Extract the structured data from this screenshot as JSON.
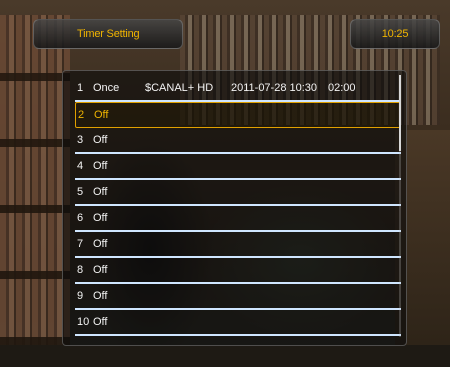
{
  "header": {
    "title": "Timer Setting",
    "clock": "10:25"
  },
  "timers": [
    {
      "index": "1",
      "mode": "Once",
      "channel": "$CANAL+ HD",
      "datetime": "2011-07-28 10:30",
      "duration": "02:00"
    },
    {
      "index": "2",
      "mode": "Off"
    },
    {
      "index": "3",
      "mode": "Off"
    },
    {
      "index": "4",
      "mode": "Off"
    },
    {
      "index": "5",
      "mode": "Off"
    },
    {
      "index": "6",
      "mode": "Off"
    },
    {
      "index": "7",
      "mode": "Off"
    },
    {
      "index": "8",
      "mode": "Off"
    },
    {
      "index": "9",
      "mode": "Off"
    },
    {
      "index": "10",
      "mode": "Off"
    }
  ],
  "selected_index": 2,
  "colors": {
    "accent": "#f0b400",
    "separator": "#cfe6ff",
    "text": "#f4f4f4"
  }
}
